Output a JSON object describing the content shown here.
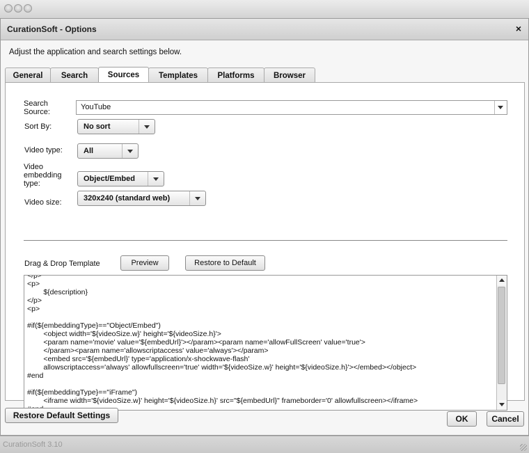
{
  "window": {
    "app_title": "CurationSoft - Options",
    "close_glyph": "×",
    "instruction": "Adjust the application and search settings below."
  },
  "tabs": [
    {
      "label": "General"
    },
    {
      "label": "Search"
    },
    {
      "label": "Sources",
      "active": true
    },
    {
      "label": "Templates"
    },
    {
      "label": "Platforms"
    },
    {
      "label": "Browser"
    }
  ],
  "sources": {
    "search_source_label": "Search Source:",
    "search_source_value": "YouTube",
    "sort_by_label": "Sort By:",
    "sort_by_value": "No sort",
    "video_type_label": "Video type:",
    "video_type_value": "All",
    "embed_type_label": "Video embedding type:",
    "embed_type_value": "Object/Embed",
    "video_size_label": "Video size:",
    "video_size_value": "320x240 (standard web)"
  },
  "template": {
    "label": "Drag & Drop Template",
    "preview_button": "Preview",
    "restore_button": "Restore to Default",
    "code": "</p>\n<p>\n        ${description}\n</p>\n<p>\n\n#if(${embeddingType}==\"Object/Embed\")\n        <object width='${videoSize.w}' height='${videoSize.h}'>\n        <param name='movie' value='${embedUrl}'></param><param name='allowFullScreen' value='true'>\n        </param><param name='allowscriptaccess' value='always'></param>\n        <embed src='${embedUrl}' type='application/x-shockwave-flash'\n        allowscriptaccess='always' allowfullscreen='true' width='${videoSize.w}' height='${videoSize.h}'></embed></object>\n#end\n\n#if(${embeddingType}==\"iFrame\")\n        <iframe width='${videoSize.w}' height='${videoSize.h}' src=\"${embedUrl}\" frameborder='0' allowfullscreen></iframe>\n#end"
  },
  "footer": {
    "restore_defaults": "Restore Default Settings",
    "ok": "OK",
    "cancel": "Cancel"
  },
  "status": {
    "text": "CurationSoft 3.10"
  }
}
